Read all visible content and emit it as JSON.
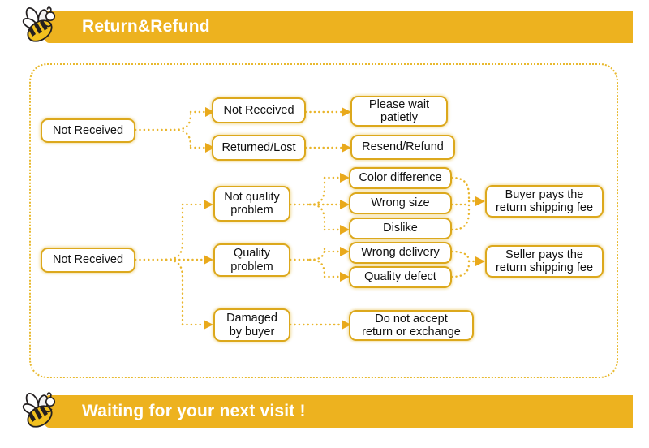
{
  "header": {
    "title": "Return&Refund",
    "icon": "bee-icon",
    "banner_color": "#EDB21F"
  },
  "footer": {
    "title": "Waiting for your next visit !",
    "icon": "bee-icon",
    "banner_color": "#EDB21F"
  },
  "panel": {
    "border_color": "#E8B92E",
    "border_style": "dotted"
  },
  "theme": {
    "node_border": "#DCA81C",
    "node_fill": "#FFFFFF",
    "connector": "#E9B52B",
    "arrow": "#E9A91B",
    "text": "#101010"
  },
  "flow": {
    "nodes": [
      {
        "id": "n1",
        "label": "Not Received"
      },
      {
        "id": "n2",
        "label": "Not Received"
      },
      {
        "id": "n3",
        "label": "Returned/Lost"
      },
      {
        "id": "n4",
        "label": "Please wait\npatietly"
      },
      {
        "id": "n5",
        "label": "Resend/Refund"
      },
      {
        "id": "n6",
        "label": "Not Received"
      },
      {
        "id": "n7",
        "label": "Not quality\nproblem"
      },
      {
        "id": "n8",
        "label": "Quality\nproblem"
      },
      {
        "id": "n9",
        "label": "Damaged\nby buyer"
      },
      {
        "id": "n10",
        "label": "Color difference"
      },
      {
        "id": "n11",
        "label": "Wrong size"
      },
      {
        "id": "n12",
        "label": "Dislike"
      },
      {
        "id": "n13",
        "label": "Wrong delivery"
      },
      {
        "id": "n14",
        "label": "Quality defect"
      },
      {
        "id": "n15",
        "label": "Do not accept\nreturn or exchange"
      },
      {
        "id": "n16",
        "label": "Buyer pays the\nreturn shipping fee"
      },
      {
        "id": "n17",
        "label": "Seller pays the\nreturn shipping fee"
      }
    ],
    "edges": [
      {
        "from": "n1",
        "to": "n2"
      },
      {
        "from": "n1",
        "to": "n3"
      },
      {
        "from": "n2",
        "to": "n4"
      },
      {
        "from": "n3",
        "to": "n5"
      },
      {
        "from": "n6",
        "to": "n7"
      },
      {
        "from": "n6",
        "to": "n8"
      },
      {
        "from": "n6",
        "to": "n9"
      },
      {
        "from": "n7",
        "to": "n10"
      },
      {
        "from": "n7",
        "to": "n11"
      },
      {
        "from": "n7",
        "to": "n12"
      },
      {
        "from": "n8",
        "to": "n13"
      },
      {
        "from": "n8",
        "to": "n14"
      },
      {
        "from": "n9",
        "to": "n15"
      },
      {
        "from": "n10",
        "to": "n16"
      },
      {
        "from": "n11",
        "to": "n16"
      },
      {
        "from": "n12",
        "to": "n16"
      },
      {
        "from": "n13",
        "to": "n17"
      },
      {
        "from": "n14",
        "to": "n17"
      }
    ]
  }
}
